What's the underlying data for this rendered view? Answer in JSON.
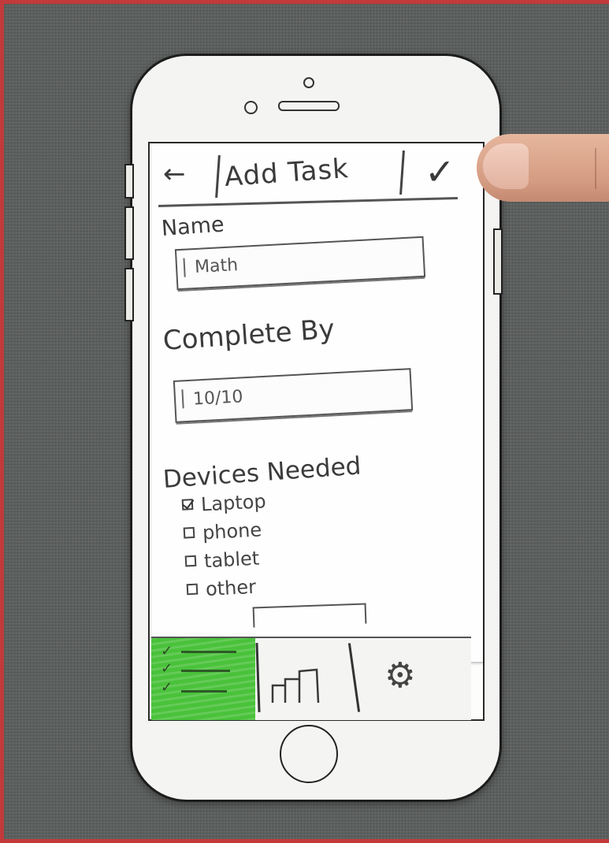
{
  "header": {
    "back_icon": "←",
    "title": "Add Task",
    "confirm_icon": "✓"
  },
  "form": {
    "name_label": "Name",
    "name_value": "Math",
    "complete_by_label": "Complete By",
    "complete_by_value": "10/10",
    "devices_label": "Devices Needed",
    "devices": [
      {
        "label": "Laptop",
        "checked": true
      },
      {
        "label": "phone",
        "checked": false
      },
      {
        "label": "tablet",
        "checked": false
      },
      {
        "label": "other",
        "checked": false
      }
    ]
  },
  "tabbar": {
    "active_color": "#4ac23b",
    "tabs": [
      {
        "name": "tasks",
        "icon": "checklist-icon",
        "active": true
      },
      {
        "name": "stats",
        "icon": "bar-chart-icon",
        "active": false
      },
      {
        "name": "settings",
        "icon": "gear-icon",
        "active": false
      }
    ],
    "task_check_glyph": "✓",
    "settings_glyph": "⚙"
  }
}
